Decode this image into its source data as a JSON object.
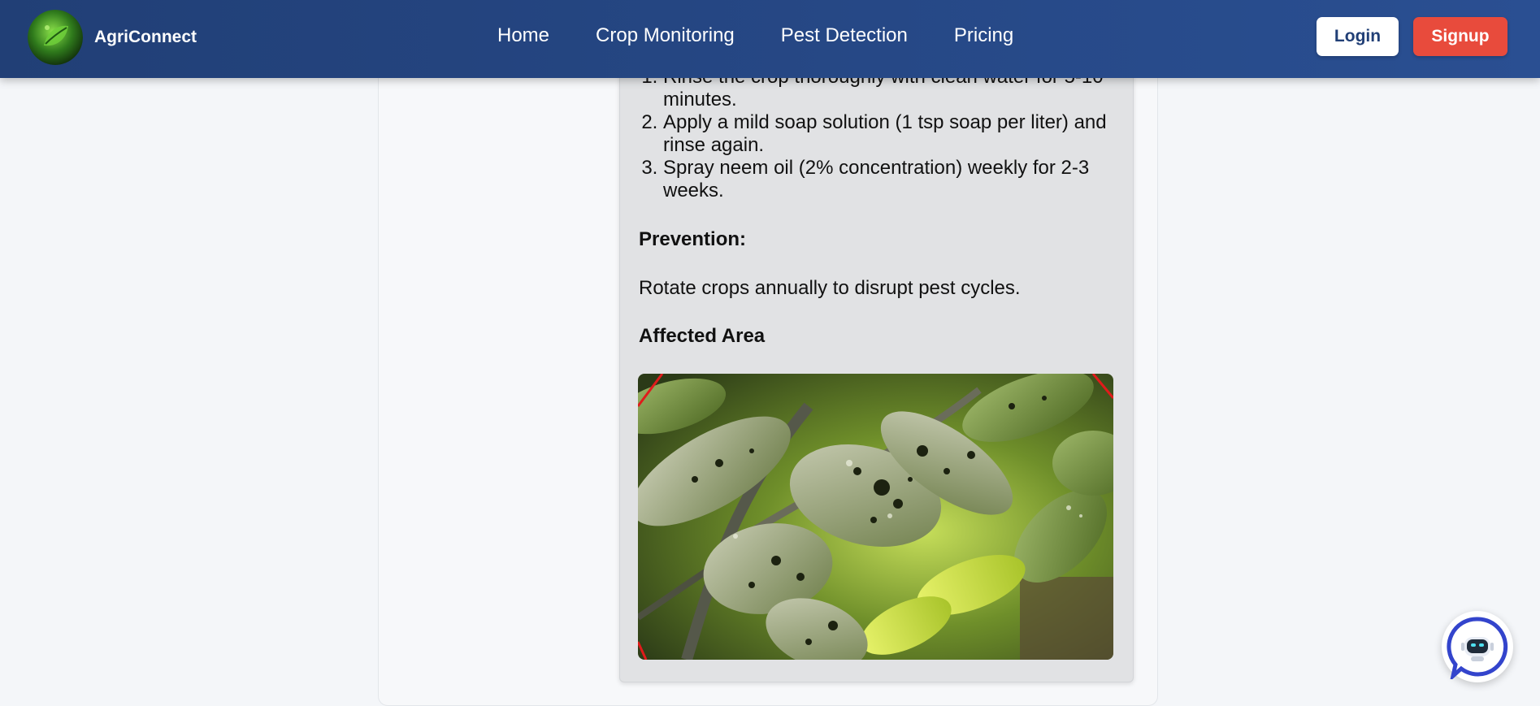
{
  "brand": {
    "name": "AgriConnect",
    "logo_icon": "leaf-globe-logo"
  },
  "nav": {
    "links": [
      {
        "label": "Home"
      },
      {
        "label": "Crop Monitoring"
      },
      {
        "label": "Pest Detection"
      },
      {
        "label": "Pricing"
      }
    ],
    "login_label": "Login",
    "signup_label": "Signup"
  },
  "result": {
    "steps": [
      "Rinse the crop thoroughly with clean water for 5-10 minutes.",
      "Apply a mild soap solution (1 tsp soap per liter) and rinse again.",
      "Spray neem oil (2% concentration) weekly for 2-3 weeks."
    ],
    "prevention_heading": "Prevention:",
    "prevention_text": "Rotate crops annually to disrupt pest cycles.",
    "affected_heading": "Affected Area",
    "affected_image_icon": "infested-leaves-photo"
  },
  "chatbot": {
    "icon": "robot-chat-icon"
  },
  "colors": {
    "nav_start": "#213f76",
    "nav_end": "#2a4f92",
    "signup": "#e84b3c",
    "login_text": "#213f76",
    "chatbot_ring": "#3344cc"
  }
}
